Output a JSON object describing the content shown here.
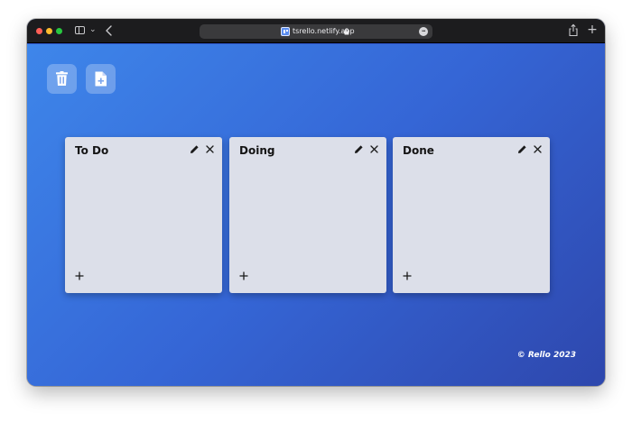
{
  "browser": {
    "url": "tsrello.netlify.app",
    "new_tab_symbol": "+"
  },
  "toolbar": {
    "actions": [
      {
        "name": "delete-board",
        "icon": "trash-icon"
      },
      {
        "name": "new-list",
        "icon": "file-plus-icon"
      }
    ]
  },
  "lists": [
    {
      "title": "To Do",
      "edit_icon": "pencil-icon",
      "close_icon": "close-icon",
      "add_icon": "plus-icon"
    },
    {
      "title": "Doing",
      "edit_icon": "pencil-icon",
      "close_icon": "close-icon",
      "add_icon": "plus-icon"
    },
    {
      "title": "Done",
      "edit_icon": "pencil-icon",
      "close_icon": "close-icon",
      "add_icon": "plus-icon"
    }
  ],
  "footer": {
    "text": "© Rello 2023"
  },
  "colors": {
    "gradient_start": "#3e86ea",
    "gradient_end": "#2e47ad",
    "list_background": "#dcdfe9",
    "title_text": "#141414"
  }
}
